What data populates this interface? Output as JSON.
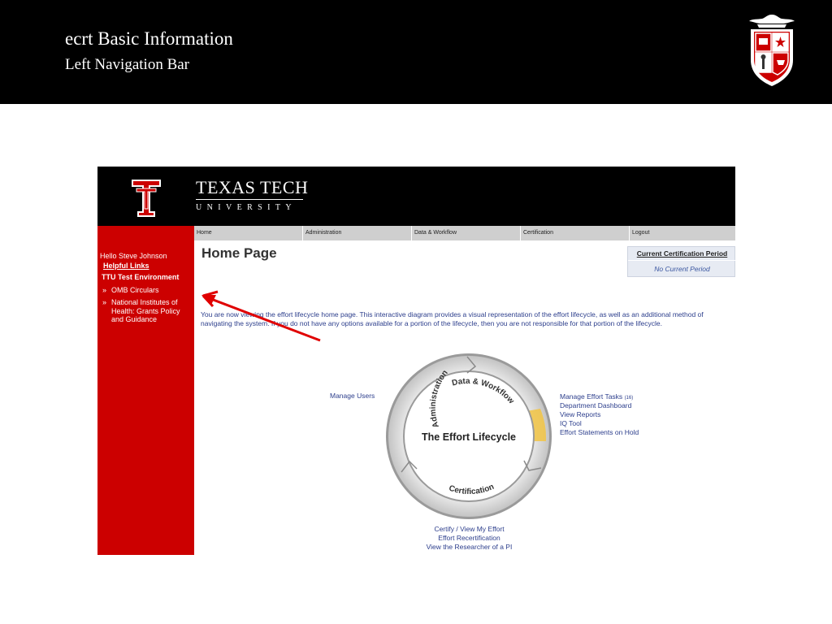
{
  "slide": {
    "title": "ecrt Basic Information",
    "subtitle": "Left Navigation Bar"
  },
  "colors": {
    "ttu_red": "#cc0000",
    "banner_black": "#000000",
    "link_blue": "#2c3e8c",
    "nav_gray": "#cfcfcf",
    "annotation_arrow": "#e00000"
  },
  "icons": {
    "slide_crest": "ttu-system-crest-icon",
    "ttu_logo": "double-t-logo-icon",
    "annotation": "red-arrow"
  },
  "ttu": {
    "name": "TEXAS TECH",
    "university": "UNIVERSITY"
  },
  "nav": {
    "tabs": [
      "Home",
      "Administration",
      "Data & Workflow",
      "Certification",
      "Logout"
    ]
  },
  "sidebar": {
    "greeting": "Hello Steve Johnson",
    "helpful_links": "Helpful Links",
    "environment": "TTU Test Environment",
    "bullet": "»",
    "links": [
      "OMB Circulars",
      "National Institutes of Health: Grants Policy and Guidance"
    ]
  },
  "page": {
    "title": "Home Page",
    "intro": "You are now viewing the effort lifecycle home page. This interactive diagram provides a visual representation of the effort lifecycle, as well as an additional method of navigating the system. If you do not have any options available for a portion of the lifecycle, then you are not responsible for that portion of the lifecycle."
  },
  "certification_period": {
    "header": "Current Certification Period",
    "value": "No Current Period"
  },
  "lifecycle": {
    "center_label": "The Effort Lifecycle",
    "segments": [
      "Administration",
      "Data & Workflow",
      "Certification"
    ],
    "admin_links": [
      "Manage Users"
    ],
    "data_links": [
      "Manage Effort Tasks",
      "Department Dashboard",
      "View Reports",
      "IQ Tool",
      "Effort Statements on Hold"
    ],
    "data_task_count": "(16)",
    "cert_links": [
      "Certify / View My Effort",
      "Effort Recertification",
      "View the Researcher of a PI"
    ]
  }
}
